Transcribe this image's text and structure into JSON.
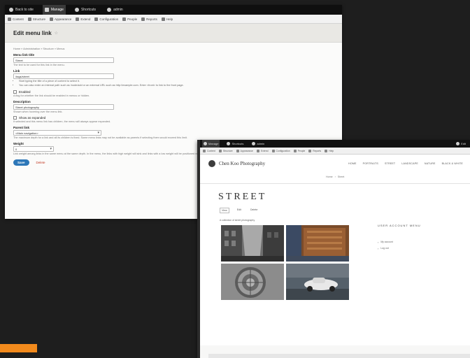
{
  "colors": {
    "orange_accent": "#f28a1c",
    "button_primary": "#2d77b8",
    "delete_red": "#c13a24"
  },
  "win1": {
    "toolbar": [
      {
        "icon": "home-icon",
        "label": "Back to site",
        "active": false
      },
      {
        "icon": "menu-icon",
        "label": "Manage",
        "active": true
      },
      {
        "icon": "star-icon",
        "label": "Shortcuts",
        "active": false
      },
      {
        "icon": "user-icon",
        "label": "admin",
        "active": false
      }
    ],
    "subbar": [
      {
        "icon": "content-icon",
        "label": "Content"
      },
      {
        "icon": "structure-icon",
        "label": "Structure"
      },
      {
        "icon": "appearance-icon",
        "label": "Appearance"
      },
      {
        "icon": "extend-icon",
        "label": "Extend"
      },
      {
        "icon": "configuration-icon",
        "label": "Configuration"
      },
      {
        "icon": "people-icon",
        "label": "People"
      },
      {
        "icon": "reports-icon",
        "label": "Reports"
      },
      {
        "icon": "help-icon",
        "label": "Help"
      }
    ],
    "page_title": "Edit menu link",
    "breadcrumb": "Home » Administration » Structure » Menus",
    "fields": {
      "title_label": "Menu link title",
      "title_value": "Street",
      "title_desc": "The text to be used for this link in the menu.",
      "link_label": "Link",
      "link_value": "/tags/street",
      "link_bullets": [
        "Start typing the title of a piece of content to select it.",
        "You can also enter an internal path such as /node/add or an external URL such as http://example.com. Enter <front> to link to the front page."
      ],
      "enabled_label": "Enabled",
      "enabled_desc": "A flag for whether the link should be enabled in menus or hidden.",
      "description_label": "Description",
      "description_value": "Street photography",
      "description_desc": "Shown when hovering over the menu link.",
      "expanded_label": "Show as expanded",
      "expanded_desc": "If selected and this menu link has children, the menu will always appear expanded.",
      "parent_label": "Parent link",
      "parent_value": "<Main navigation>",
      "parent_desc": "The maximum depth for a link and all its children is fixed. Some menu links may not be available as parents if selecting them would exceed this limit.",
      "weight_label": "Weight",
      "weight_value": "0",
      "weight_desc": "Link weight among links in the same menu at the same depth. In the menu, the links with high weight will sink and links with a low weight will be positioned nearer the top."
    },
    "save_label": "Save",
    "delete_label": "Delete"
  },
  "win2": {
    "toolbar": [
      {
        "icon": "menu-icon",
        "label": "Manage",
        "active": true
      },
      {
        "icon": "star-icon",
        "label": "Shortcuts",
        "active": false
      },
      {
        "icon": "user-icon",
        "label": "admin",
        "active": false
      }
    ],
    "user_label": "Edit",
    "subbar": [
      {
        "icon": "content-icon",
        "label": "Content"
      },
      {
        "icon": "structure-icon",
        "label": "Structure"
      },
      {
        "icon": "appearance-icon",
        "label": "Appearance"
      },
      {
        "icon": "extend-icon",
        "label": "Extend"
      },
      {
        "icon": "configuration-icon",
        "label": "Configuration"
      },
      {
        "icon": "people-icon",
        "label": "People"
      },
      {
        "icon": "reports-icon",
        "label": "Reports"
      },
      {
        "icon": "help-icon",
        "label": "Help"
      }
    ],
    "brand_name": "Chen Koo Photography",
    "nav": [
      "Home",
      "Portraits",
      "Street",
      "Landscape",
      "Nature",
      "Black & White"
    ],
    "breadcrumb": [
      "Home",
      "Street"
    ],
    "page_heading": "STREET",
    "tabs": [
      {
        "label": "View",
        "active": true
      },
      {
        "label": "Edit",
        "active": false
      },
      {
        "label": "Delete",
        "active": false
      }
    ],
    "intro": "A collection of street photography",
    "sidebar_title": "USER ACCOUNT MENU",
    "sidebar_links": [
      "My account",
      "Log out"
    ],
    "photos": [
      {
        "alt": "city street with tall buildings"
      },
      {
        "alt": "wooden doorway"
      },
      {
        "alt": "manhole cover"
      },
      {
        "alt": "white car on road"
      }
    ]
  }
}
